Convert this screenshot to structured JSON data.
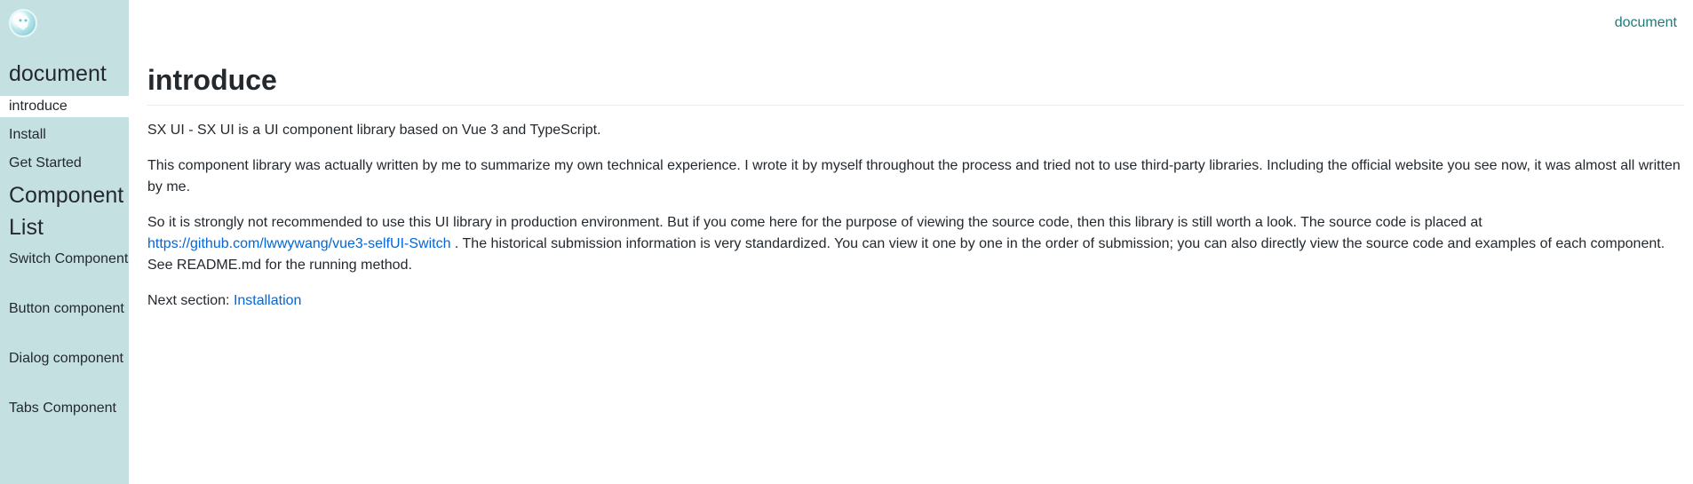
{
  "header": {
    "nav_link": "document"
  },
  "sidebar": {
    "section_title": "document",
    "items": [
      {
        "label": "introduce"
      },
      {
        "label": "Install"
      },
      {
        "label": "Get Started"
      }
    ],
    "component_section_title": "Component List",
    "component_items": [
      {
        "label": "Switch Component"
      },
      {
        "label": "Button component"
      },
      {
        "label": "Dialog component"
      },
      {
        "label": "Tabs Component"
      }
    ]
  },
  "main": {
    "title": "introduce",
    "paragraph1": "SX UI - SX UI is a UI component library based on Vue 3 and TypeScript.",
    "paragraph2": "This component library was actually written by me to summarize my own technical experience. I wrote it by myself throughout the process and tried not to use third-party libraries. Including the official website you see now, it was almost all written by me.",
    "paragraph3_before": "So it is strongly not recommended to use this UI library in production environment. But if you come here for the purpose of viewing the source code, then this library is still worth a look. The source code is placed at",
    "paragraph3_link": "https://github.com/lwwywang/vue3-selfUI-Switch",
    "paragraph3_after": ". The historical submission information is very standardized. You can view it one by one in the order of submission; you can also directly view the source code and examples of each component. See README.md for the running method.",
    "next_label": "Next section:",
    "next_link": "Installation"
  }
}
